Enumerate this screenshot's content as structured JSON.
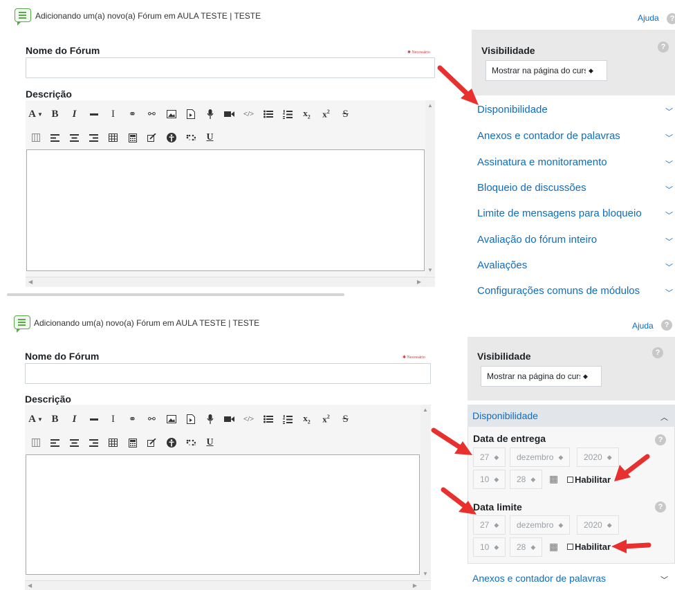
{
  "header": {
    "title": "Adicionando um(a) novo(a) Fórum em AULA TESTE | TESTE",
    "help": "Ajuda"
  },
  "form": {
    "name_label": "Nome do Fórum",
    "required_note": "Necessário",
    "name_value": "",
    "description_label": "Descrição",
    "editor_value": ""
  },
  "toolbar": {
    "row1": [
      "font-size-icon",
      "bold-icon",
      "italic-icon",
      "horizontal-rule-icon",
      "clear-formatting-icon",
      "link-icon",
      "unlink-icon",
      "image-icon",
      "media-icon",
      "record-audio-icon",
      "record-video-icon",
      "html-icon",
      "bullet-list-icon",
      "numbered-list-icon",
      "subscript-icon",
      "superscript-icon",
      "strikethrough-icon"
    ],
    "row2": [
      "column-layout-icon",
      "align-left-icon",
      "align-center-icon",
      "align-right-icon",
      "table-icon",
      "calculator-icon",
      "edit-icon",
      "accessibility-icon",
      "braille-icon",
      "underline-icon"
    ]
  },
  "sidebar": {
    "visibility_label": "Visibilidade",
    "visibility_value": "Mostrar na página do curso",
    "sections": [
      "Disponibilidade",
      "Anexos e contador de palavras",
      "Assinatura e monitoramento",
      "Bloqueio de discussões",
      "Limite de mensagens para bloqueio",
      "Avaliação do fórum inteiro",
      "Avaliações",
      "Configurações comuns de módulos"
    ]
  },
  "availability": {
    "title": "Disponibilidade",
    "due_label": "Data de entrega",
    "cutoff_label": "Data limite",
    "day": "27",
    "month": "dezembro",
    "year": "2020",
    "hour": "10",
    "minute": "28",
    "enable_label": "Habilitar",
    "next_section": "Anexos e contador de palavras"
  },
  "colors": {
    "link": "#0f6cbf",
    "annotation": "#e8312e",
    "forum_icon": "#5aa84a"
  }
}
